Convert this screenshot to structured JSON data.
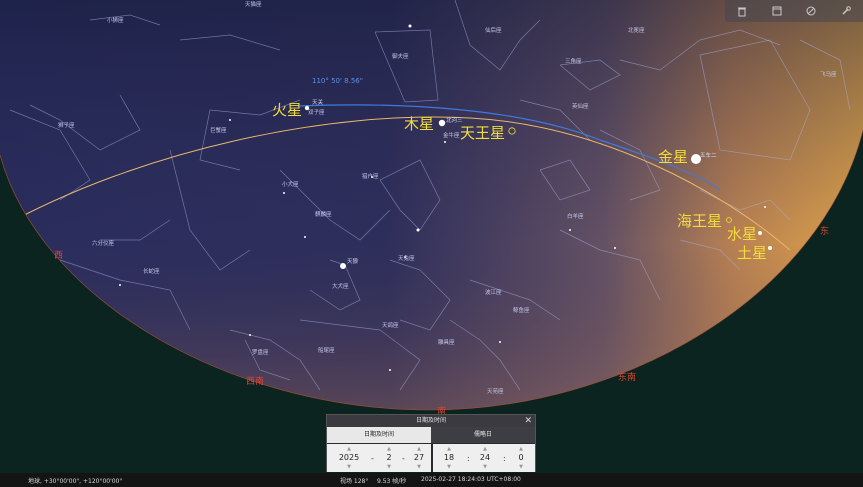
{
  "toolbar": {
    "icons": [
      "trash-icon",
      "window-icon",
      "eye-off-icon",
      "wrench-icon"
    ]
  },
  "sky": {
    "planets": {
      "mars": "火星",
      "jupiter": "木星",
      "uranus": "天王星",
      "venus": "金星",
      "neptune": "海王星",
      "mercury": "水星",
      "saturn": "土星"
    },
    "coord_readout": "110° 50' 8.56\"",
    "stars": {
      "tianguan": "天关",
      "wuche": "五车二",
      "beihe": "北河三",
      "tianlang": "天狼"
    },
    "constellations": {
      "xiaoxiong": "小狮座",
      "dashi": "天猫座",
      "xianhou": "仙后座",
      "yufu": "御夫座",
      "shuangzi": "双子座",
      "jinniu": "金牛座",
      "juxie": "巨蟹座",
      "xiaoquan": "小犬座",
      "shizi": "狮子座",
      "liuyi": "六分仪座",
      "changshe": "长蛇座",
      "qilin": "麒麟座",
      "liehu": "猎户座",
      "daquan": "大犬座",
      "tianshe": "天兔座",
      "baiyang": "白羊座",
      "yingxianzuo": "英仙座",
      "shuangyu": "双鱼座",
      "tianyuan": "天苑座",
      "jingyu": "鲸鱼座",
      "tiangu": "天鸽座",
      "yunlu": "雕具座",
      "xiaoma": "飞马座",
      "luopan": "罗盘座",
      "chuanwei": "船尾座",
      "chuanfan": "船帆座",
      "sanjiao": "三角座",
      "jiabo": "天大座",
      "lulu": "波江座",
      "beiwei": "北冕座"
    },
    "cardinals": {
      "west": "西",
      "south": "南",
      "east": "东",
      "southwest": "西南",
      "southeast": "东南"
    }
  },
  "datetime_dialog": {
    "title": "日期及时间",
    "tab_datetime": "日期及时间",
    "tab_julian": "儒略日",
    "year": "2025",
    "month": "2",
    "day": "27",
    "hour": "18",
    "minute": "24",
    "second": "0"
  },
  "status": {
    "location": "地球, +30°00'00\", +120°00'00\"",
    "fov": "视场 128°",
    "fps": "9.53 帧/秒",
    "datetime": "2025-02-27 18:24:03 UTC+08:00"
  },
  "colors": {
    "planet_label": "#f2dd3c",
    "ecliptic": "#e8b86a",
    "equator": "#3f79d9",
    "ground": "#0c2420",
    "cardinal": "#e0442a"
  }
}
